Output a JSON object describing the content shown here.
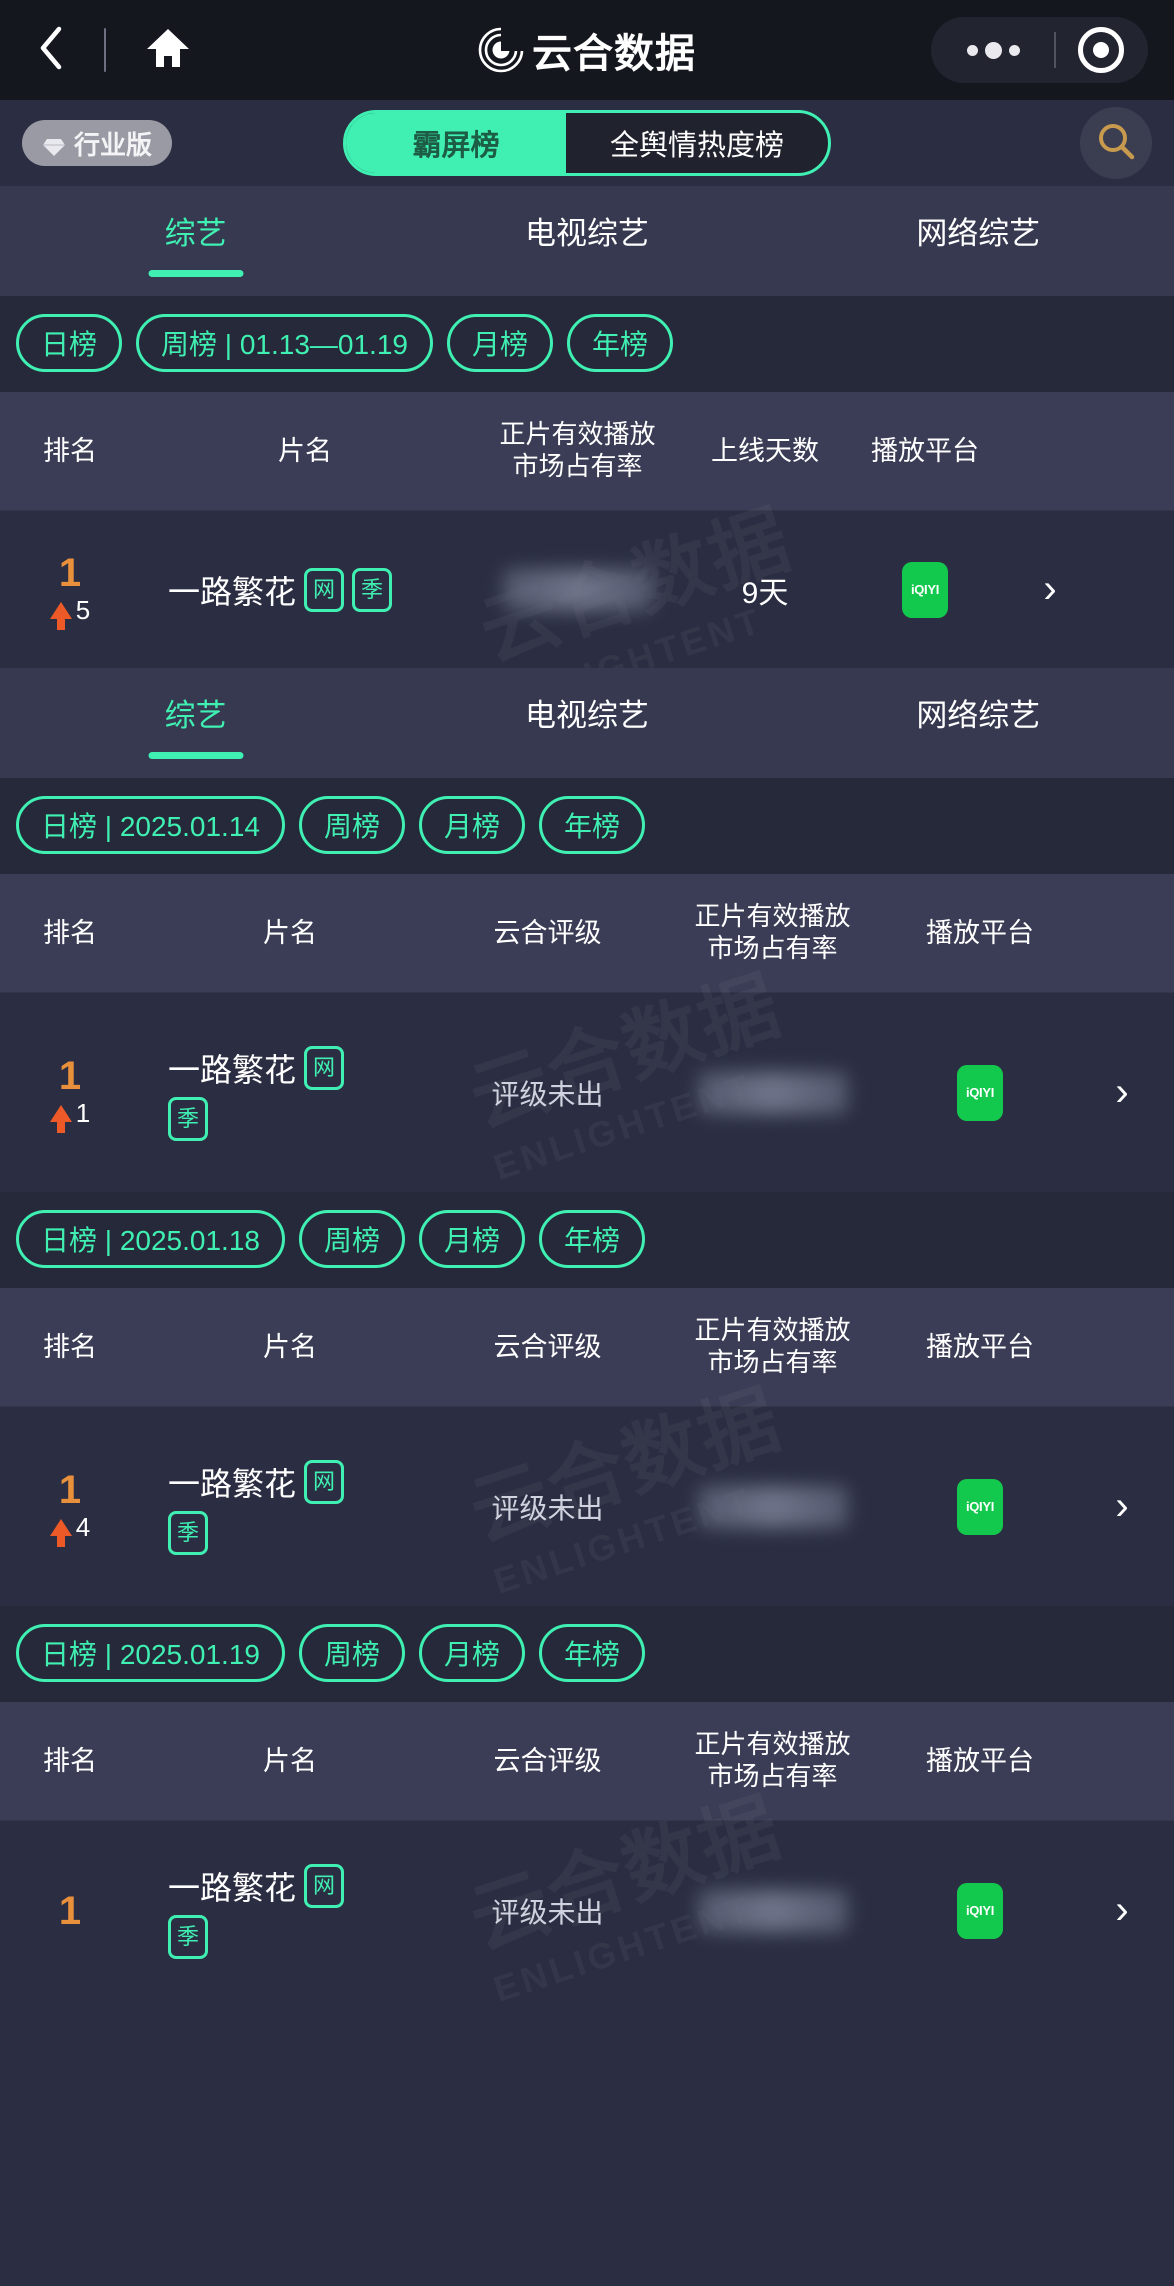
{
  "navbar": {
    "back_icon": "chevron-left-icon",
    "home_icon": "home-icon",
    "logo_icon": "yunhe-logo-icon",
    "title": "云合数据",
    "more_icon": "more-dots-icon",
    "capsule_icon": "target-circle-icon"
  },
  "toolbar": {
    "pro_badge": "行业版",
    "gem_icon": "gem-icon",
    "segments": [
      {
        "label": "霸屏榜",
        "active": true
      },
      {
        "label": "全舆情热度榜",
        "active": false
      }
    ],
    "search_icon": "search-icon"
  },
  "category_tabs": [
    "综艺",
    "电视综艺",
    "网络综艺"
  ],
  "active_category": "综艺",
  "sections": [
    {
      "chips": [
        {
          "label": "日榜"
        },
        {
          "label": "周榜 | 01.13—01.19"
        },
        {
          "label": "月榜"
        },
        {
          "label": "年榜"
        }
      ],
      "columns": [
        "排名",
        "片名",
        "正片有效播放\n市场占有率",
        "上线天数",
        "播放平台"
      ],
      "columns_flat": [
        "排名",
        "片名",
        "正片有效播放",
        "市场占有率",
        "上线天数",
        "播放平台"
      ],
      "rows": [
        {
          "rank": "1",
          "rank_change_dir": "up",
          "rank_change": "5",
          "title": "一路繁花",
          "tags": [
            "网",
            "季"
          ],
          "share": "",
          "days": "9天",
          "platform": "iQIYI",
          "chevron": "›"
        }
      ]
    },
    {
      "tabs": [
        "综艺",
        "电视综艺",
        "网络综艺"
      ],
      "active_tab": "综艺",
      "chips": [
        {
          "label": "日榜 | 2025.01.14"
        },
        {
          "label": "周榜"
        },
        {
          "label": "月榜"
        },
        {
          "label": "年榜"
        }
      ],
      "columns_flat": [
        "排名",
        "片名",
        "云合评级",
        "正片有效播放",
        "市场占有率",
        "播放平台"
      ],
      "rows": [
        {
          "rank": "1",
          "rank_change_dir": "up",
          "rank_change": "1",
          "title": "一路繁花",
          "tags": [
            "网",
            "季"
          ],
          "grade": "评级未出",
          "share": "",
          "platform": "iQIYI",
          "chevron": "›"
        }
      ]
    },
    {
      "chips": [
        {
          "label": "日榜 | 2025.01.18"
        },
        {
          "label": "周榜"
        },
        {
          "label": "月榜"
        },
        {
          "label": "年榜"
        }
      ],
      "columns_flat": [
        "排名",
        "片名",
        "云合评级",
        "正片有效播放",
        "市场占有率",
        "播放平台"
      ],
      "rows": [
        {
          "rank": "1",
          "rank_change_dir": "up",
          "rank_change": "4",
          "title": "一路繁花",
          "tags": [
            "网",
            "季"
          ],
          "grade": "评级未出",
          "share": "",
          "platform": "iQIYI",
          "chevron": "›"
        }
      ]
    },
    {
      "chips": [
        {
          "label": "日榜 | 2025.01.19"
        },
        {
          "label": "周榜"
        },
        {
          "label": "月榜"
        },
        {
          "label": "年榜"
        }
      ],
      "columns_flat": [
        "排名",
        "片名",
        "云合评级",
        "正片有效播放",
        "市场占有率",
        "播放平台"
      ],
      "rows": [
        {
          "rank": "1",
          "rank_change_dir": "none",
          "rank_change": "",
          "title": "一路繁花",
          "tags": [
            "网",
            "季"
          ],
          "grade": "评级未出",
          "share": "",
          "platform": "iQIYI",
          "chevron": "›"
        }
      ]
    }
  ],
  "watermark": {
    "line1": "云合数据",
    "line2": "ENLIGHTENT"
  },
  "colors": {
    "accent": "#3ff0b2",
    "bg": "#2b2e42",
    "navbar_bg": "#15171f",
    "tabs_bg": "#363950",
    "chips_bg": "#262939",
    "header_bg": "#3a3d55",
    "rank": "#e8903c",
    "rank_up": "#ed5a27",
    "platform_green": "#13c94d"
  }
}
